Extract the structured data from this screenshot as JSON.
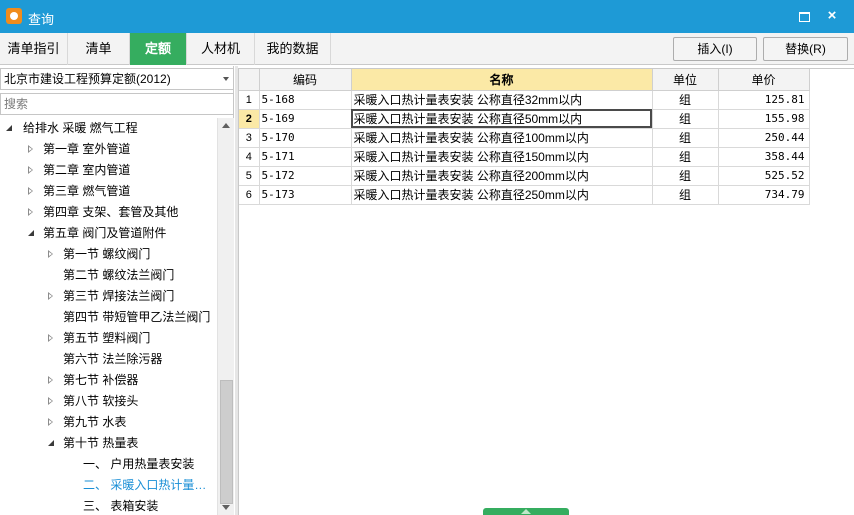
{
  "window": {
    "title": "查询",
    "accent": "#1e9ad6",
    "icon": "app-logo-icon",
    "controls": {
      "maximize": "window-maximize-icon",
      "close": "×"
    }
  },
  "tabs": [
    {
      "label": "清单指引",
      "active": false
    },
    {
      "label": "清单",
      "active": false
    },
    {
      "label": "定额",
      "active": true
    },
    {
      "label": "人材机",
      "active": false
    },
    {
      "label": "我的数据",
      "active": false
    }
  ],
  "toolbar": {
    "insert_label": "插入(I)",
    "replace_label": "替换(R)"
  },
  "left": {
    "quota_library": "北京市建设工程预算定额(2012)",
    "search_placeholder": "搜索",
    "tree": [
      {
        "label": "给排水 采暖 燃气工程",
        "level": 0,
        "state": "open"
      },
      {
        "label": "第一章 室外管道",
        "level": 1,
        "state": "closed"
      },
      {
        "label": "第二章 室内管道",
        "level": 1,
        "state": "closed"
      },
      {
        "label": "第三章 燃气管道",
        "level": 1,
        "state": "closed"
      },
      {
        "label": "第四章 支架、套管及其他",
        "level": 1,
        "state": "closed"
      },
      {
        "label": "第五章 阀门及管道附件",
        "level": 1,
        "state": "open"
      },
      {
        "label": "第一节 螺纹阀门",
        "level": 2,
        "state": "closed"
      },
      {
        "label": "第二节 螺纹法兰阀门",
        "level": 2,
        "state": "leaf"
      },
      {
        "label": "第三节 焊接法兰阀门",
        "level": 2,
        "state": "closed"
      },
      {
        "label": "第四节 带短管甲乙法兰阀门",
        "level": 2,
        "state": "leaf"
      },
      {
        "label": "第五节 塑料阀门",
        "level": 2,
        "state": "closed"
      },
      {
        "label": "第六节 法兰除污器",
        "level": 2,
        "state": "leaf"
      },
      {
        "label": "第七节 补偿器",
        "level": 2,
        "state": "closed"
      },
      {
        "label": "第八节 软接头",
        "level": 2,
        "state": "closed"
      },
      {
        "label": "第九节 水表",
        "level": 2,
        "state": "closed"
      },
      {
        "label": "第十节 热量表",
        "level": 2,
        "state": "open"
      },
      {
        "label": "一、 户用热量表安装",
        "level": 3,
        "state": "leaf"
      },
      {
        "label": "二、 采暖入口热计量…",
        "level": 3,
        "state": "leaf",
        "selected": true
      },
      {
        "label": "三、 表箱安装",
        "level": 3,
        "state": "leaf"
      }
    ]
  },
  "grid": {
    "columns": [
      "编码",
      "名称",
      "单位",
      "单价"
    ],
    "current_row": 1,
    "rows": [
      {
        "no": "1",
        "code": "5-168",
        "name": "采暖入口热计量表安装 公称直径32mm以内",
        "unit": "组",
        "price": "125.81"
      },
      {
        "no": "2",
        "code": "5-169",
        "name": "采暖入口热计量表安装 公称直径50mm以内",
        "unit": "组",
        "price": "155.98"
      },
      {
        "no": "3",
        "code": "5-170",
        "name": "采暖入口热计量表安装 公称直径100mm以内",
        "unit": "组",
        "price": "250.44"
      },
      {
        "no": "4",
        "code": "5-171",
        "name": "采暖入口热计量表安装 公称直径150mm以内",
        "unit": "组",
        "price": "358.44"
      },
      {
        "no": "5",
        "code": "5-172",
        "name": "采暖入口热计量表安装 公称直径200mm以内",
        "unit": "组",
        "price": "525.52"
      },
      {
        "no": "6",
        "code": "5-173",
        "name": "采暖入口热计量表安装 公称直径250mm以内",
        "unit": "组",
        "price": "734.79"
      }
    ]
  }
}
